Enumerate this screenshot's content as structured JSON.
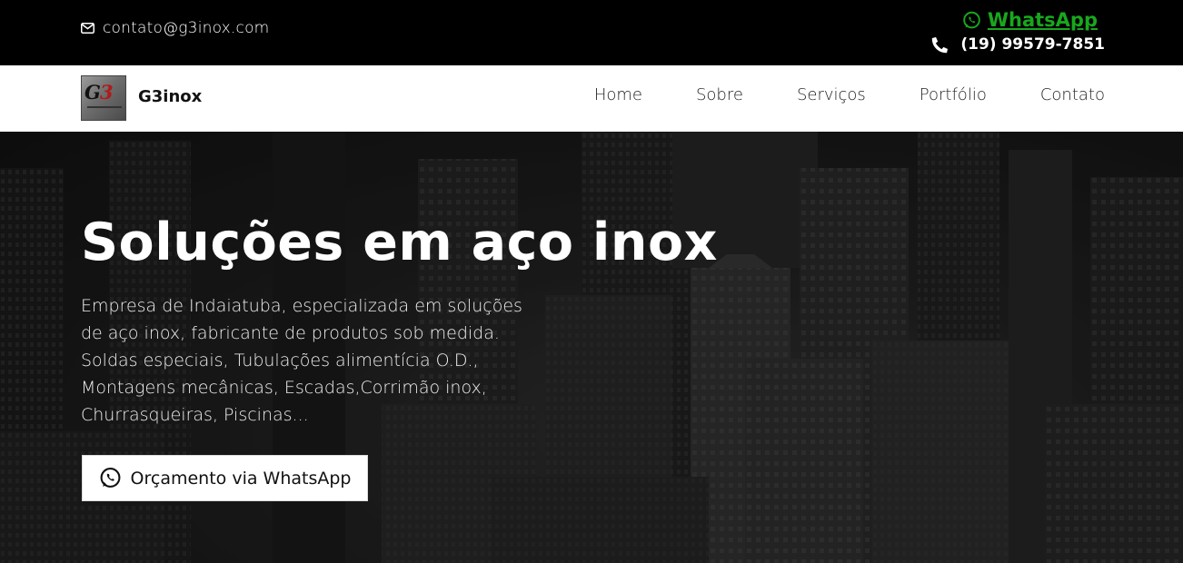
{
  "topbar": {
    "email": "contato@g3inox.com",
    "whatsapp_label": "WhatsApp",
    "phone": "(19) 99579-7851",
    "accent_color": "#18a71e"
  },
  "header": {
    "logo_text_primary": "G",
    "logo_text_accent": "3",
    "brand": "G3inox",
    "nav": [
      "Home",
      "Sobre",
      "Serviços",
      "Portfólio",
      "Contato"
    ]
  },
  "hero": {
    "title": "Soluções em aço inox",
    "description": "Empresa de Indaiatuba, especializada em soluções de aço inox, fabricante de produtos sob medida. Soldas especiais, Tubulações alimentícia O.D., Montagens mecânicas, Escadas,Corrimão inox, Churrasqueiras, Piscinas...",
    "cta_label": "Orçamento via WhatsApp"
  },
  "icons": {
    "email": "envelope-icon",
    "whatsapp": "whatsapp-icon",
    "phone": "phone-icon",
    "cta": "whatsapp-icon"
  }
}
